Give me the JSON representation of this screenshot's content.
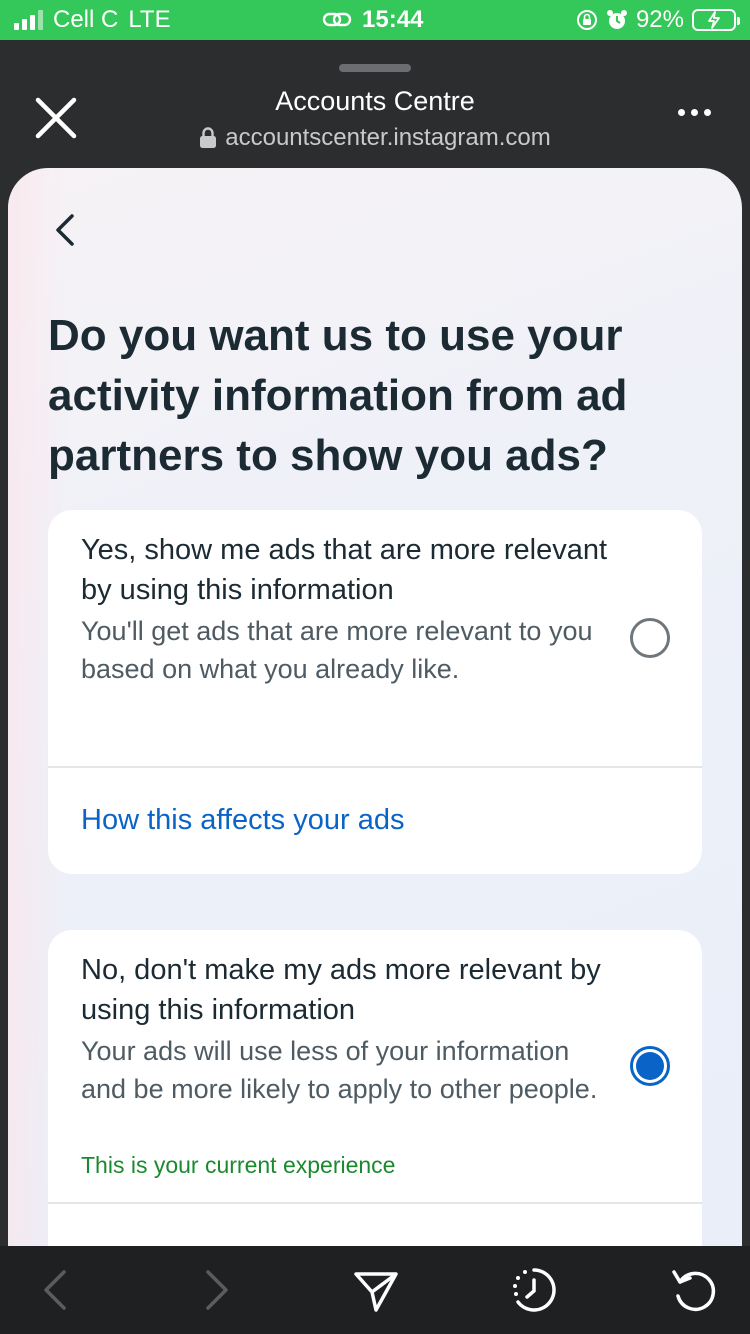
{
  "status_bar": {
    "carrier": "Cell C",
    "network": "LTE",
    "time": "15:44",
    "battery": "92%",
    "bg_color": "#34c759"
  },
  "browser": {
    "title": "Accounts Centre",
    "url": "accountscenter.instagram.com",
    "close_icon": "close-icon",
    "more_icon": "more-icon",
    "lock_icon": "lock-icon"
  },
  "page": {
    "question": "Do you want us to use your activity information from ad partners to show you ads?",
    "options": [
      {
        "title": "Yes, show me ads that are more relevant by using this information",
        "description": "You'll get ads that are more relevant to you based on what you already like.",
        "selected": false,
        "link": "How this affects your ads"
      },
      {
        "title": "No, don't make my ads more relevant by using this information",
        "description": "Your ads will use less of your information and be more likely to apply to other people.",
        "current_note": "This is your current experience",
        "selected": true
      }
    ],
    "accent_color": "#0a64c8",
    "current_color": "#1b8a2f"
  },
  "toolbar": {
    "icons": [
      "back-arrow-icon",
      "forward-arrow-icon",
      "share-icon",
      "history-icon",
      "refresh-icon"
    ]
  }
}
